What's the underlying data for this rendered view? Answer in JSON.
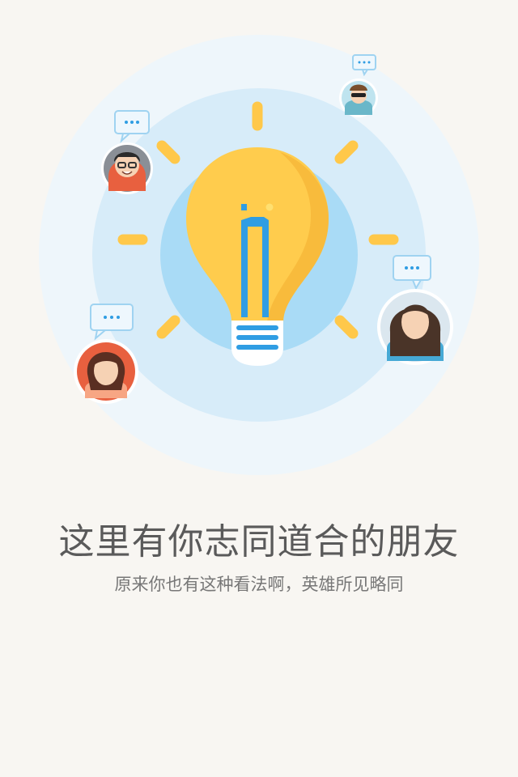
{
  "onboarding": {
    "headline": "这里有你志同道合的朋友",
    "subline": "原来你也有这种看法啊，英雄所见略同"
  },
  "colors": {
    "background": "#f8f6f2",
    "ring_outer": "#e9f4fb",
    "ring_middle": "#cde8f8",
    "ring_inner": "#a9daf6",
    "bulb_yellow": "#ffcc4d",
    "bulb_yellow_dark": "#f7b73a",
    "accent_blue": "#2f9de3"
  },
  "icons": {
    "bulb": "lightbulb-icon",
    "chat": "chat-bubble-icon",
    "avatar": "user-avatar"
  }
}
